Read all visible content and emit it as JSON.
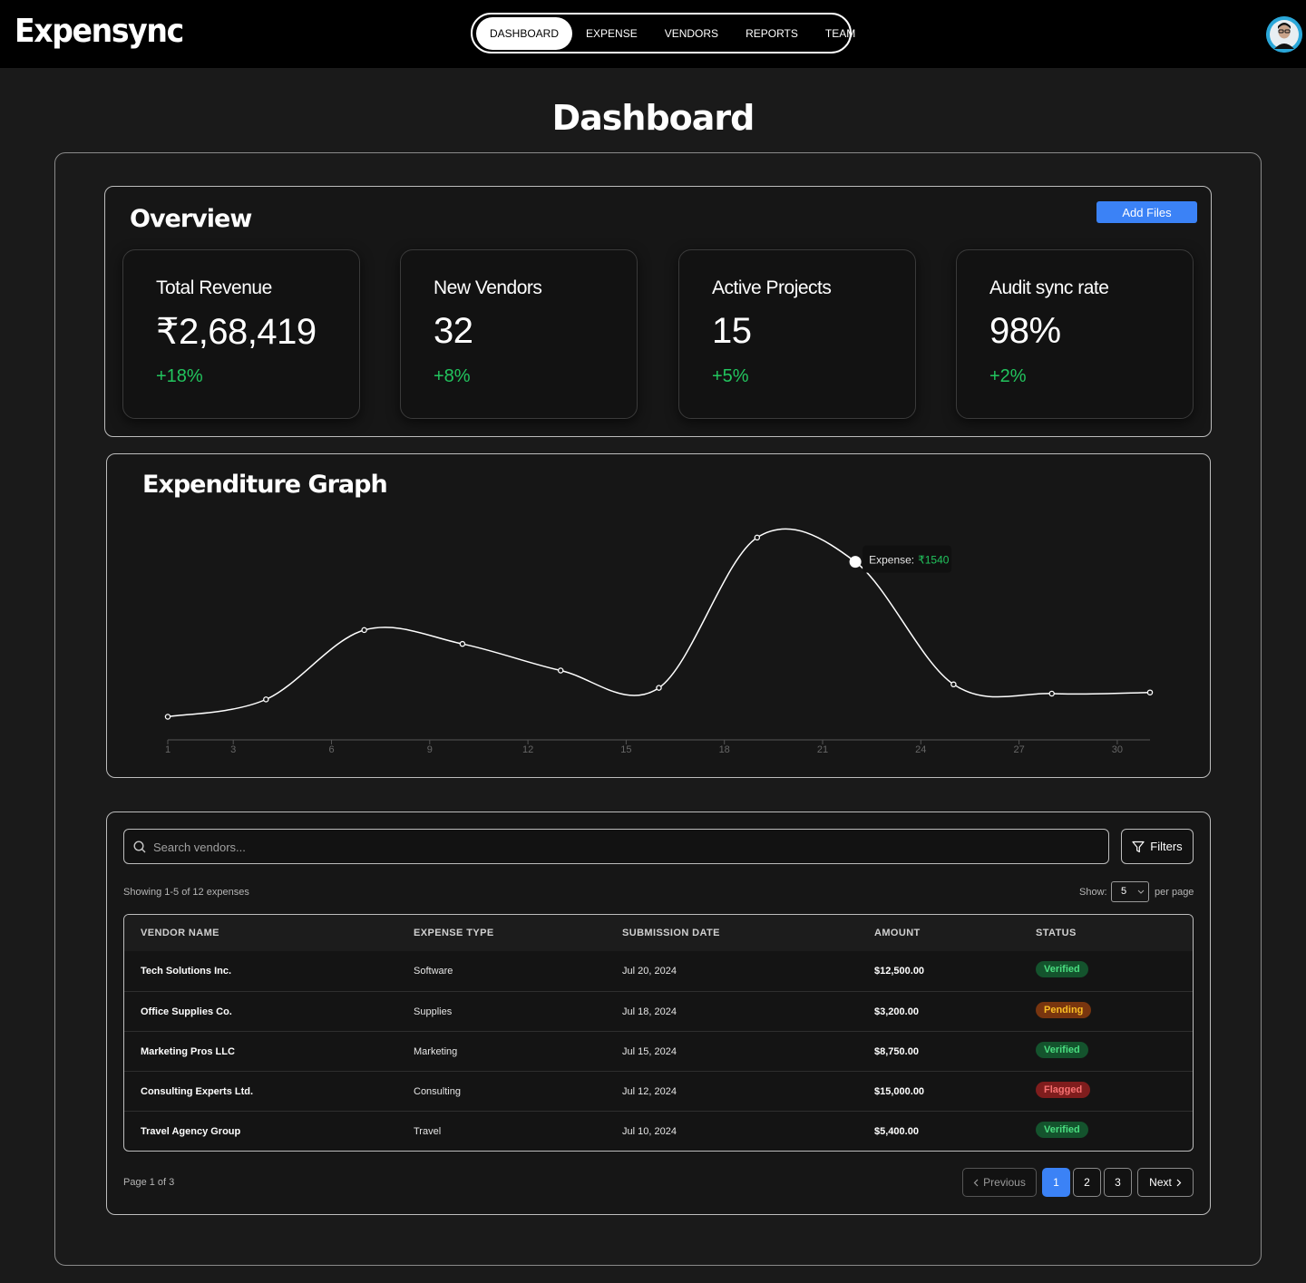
{
  "app": {
    "brand": "Expensync"
  },
  "nav": {
    "items": [
      {
        "label": "DASHBOARD",
        "active": true
      },
      {
        "label": "EXPENSE",
        "active": false
      },
      {
        "label": "VENDORS",
        "active": false
      },
      {
        "label": "REPORTS",
        "active": false
      },
      {
        "label": "TEAM",
        "active": false
      }
    ]
  },
  "page": {
    "title": "Dashboard"
  },
  "overview": {
    "title": "Overview",
    "add_files_label": "Add Files",
    "stats": [
      {
        "label": "Total Revenue",
        "value": "₹2,68,419",
        "change": "+18%"
      },
      {
        "label": "New Vendors",
        "value": "32",
        "change": "+8%"
      },
      {
        "label": "Active Projects",
        "value": "15",
        "change": "+5%"
      },
      {
        "label": "Audit sync rate",
        "value": "98%",
        "change": "+2%"
      }
    ]
  },
  "graph": {
    "title": "Expenditure Graph",
    "tooltip_label": "Expense:",
    "tooltip_value": "₹1540"
  },
  "chart_data": {
    "type": "line",
    "title": "Expenditure Graph",
    "x": [
      1,
      4,
      7,
      10,
      13,
      16,
      19,
      22,
      25,
      28,
      31
    ],
    "series": [
      {
        "values": [
          200,
          350,
          950,
          830,
          600,
          450,
          1750,
          1540,
          480,
          400,
          410
        ]
      }
    ],
    "xticks": [
      1,
      3,
      6,
      9,
      12,
      15,
      18,
      21,
      24,
      27,
      30
    ],
    "xlim": [
      1,
      31
    ],
    "ylim": [
      0,
      2000
    ],
    "highlight_index": 7,
    "grid": false,
    "colors": {
      "line": "#ffffff",
      "tooltip_value": "#22c55e"
    }
  },
  "table": {
    "search_placeholder": "Search vendors...",
    "filters_label": "Filters",
    "showing_text": "Showing 1-5 of 12 expenses",
    "show_label": "Show:",
    "per_page_value": "5",
    "per_page_label": "per page",
    "columns": [
      "VENDOR NAME",
      "EXPENSE TYPE",
      "SUBMISSION DATE",
      "AMOUNT",
      "STATUS"
    ],
    "rows": [
      {
        "vendor": "Tech Solutions Inc.",
        "type": "Software",
        "date": "Jul 20, 2024",
        "amount": "$12,500.00",
        "status": "Verified",
        "status_kind": "verified"
      },
      {
        "vendor": "Office Supplies Co.",
        "type": "Supplies",
        "date": "Jul 18, 2024",
        "amount": "$3,200.00",
        "status": "Pending",
        "status_kind": "pending"
      },
      {
        "vendor": "Marketing Pros LLC",
        "type": "Marketing",
        "date": "Jul 15, 2024",
        "amount": "$8,750.00",
        "status": "Verified",
        "status_kind": "verified"
      },
      {
        "vendor": "Consulting Experts Ltd.",
        "type": "Consulting",
        "date": "Jul 12, 2024",
        "amount": "$15,000.00",
        "status": "Flagged",
        "status_kind": "flagged"
      },
      {
        "vendor": "Travel Agency Group",
        "type": "Travel",
        "date": "Jul 10, 2024",
        "amount": "$5,400.00",
        "status": "Verified",
        "status_kind": "verified"
      }
    ]
  },
  "pagination": {
    "page_text": "Page 1 of 3",
    "previous_label": "Previous",
    "next_label": "Next",
    "pages": [
      "1",
      "2",
      "3"
    ],
    "current": "1"
  },
  "icons": {
    "search": "search-icon",
    "filter": "filter-icon",
    "chevron_left": "chevron-left-icon",
    "chevron_right": "chevron-right-icon",
    "chevron_down": "chevron-down-icon",
    "avatar": "avatar"
  }
}
